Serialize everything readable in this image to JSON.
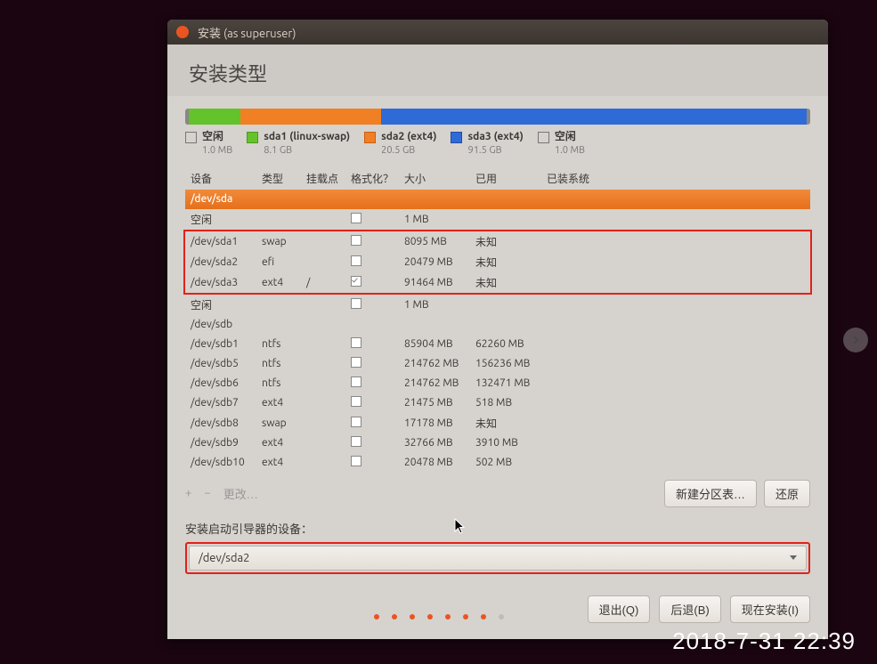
{
  "window_title": "安装 (as superuser)",
  "page_title": "安装类型",
  "legend": [
    {
      "label": "空闲",
      "sub": "1.0 MB",
      "cls": "sq-empty"
    },
    {
      "label": "sda1 (linux-swap)",
      "sub": "8.1 GB",
      "cls": "sq-green"
    },
    {
      "label": "sda2 (ext4)",
      "sub": "20.5 GB",
      "cls": "sq-orange"
    },
    {
      "label": "sda3 (ext4)",
      "sub": "91.5 GB",
      "cls": "sq-blue"
    },
    {
      "label": "空闲",
      "sub": "1.0 MB",
      "cls": "sq-empty"
    }
  ],
  "columns": {
    "device": "设备",
    "type": "类型",
    "mount": "挂载点",
    "format": "格式化？",
    "size": "大小",
    "used": "已用",
    "system": "已装系统"
  },
  "disk_a": "/dev/sda",
  "rows_a_pre": [
    {
      "device": "空闲",
      "type": "",
      "mount": "",
      "fmt": false,
      "size": "1 MB",
      "used": ""
    }
  ],
  "rows_a_boxed": [
    {
      "device": "/dev/sda1",
      "type": "swap",
      "mount": "",
      "fmt": false,
      "size": "8095 MB",
      "used": "未知"
    },
    {
      "device": "/dev/sda2",
      "type": "efi",
      "mount": "",
      "fmt": false,
      "size": "20479 MB",
      "used": "未知"
    },
    {
      "device": "/dev/sda3",
      "type": "ext4",
      "mount": "/",
      "fmt": true,
      "size": "91464 MB",
      "used": "未知"
    }
  ],
  "rows_a_post": [
    {
      "device": "空闲",
      "type": "",
      "mount": "",
      "fmt": false,
      "size": "1 MB",
      "used": ""
    }
  ],
  "disk_b": "/dev/sdb",
  "rows_b": [
    {
      "device": "/dev/sdb1",
      "type": "ntfs",
      "mount": "",
      "fmt": false,
      "size": "85904 MB",
      "used": "62260 MB"
    },
    {
      "device": "/dev/sdb5",
      "type": "ntfs",
      "mount": "",
      "fmt": false,
      "size": "214762 MB",
      "used": "156236 MB"
    },
    {
      "device": "/dev/sdb6",
      "type": "ntfs",
      "mount": "",
      "fmt": false,
      "size": "214762 MB",
      "used": "132471 MB"
    },
    {
      "device": "/dev/sdb7",
      "type": "ext4",
      "mount": "",
      "fmt": false,
      "size": "21475 MB",
      "used": "518 MB"
    },
    {
      "device": "/dev/sdb8",
      "type": "swap",
      "mount": "",
      "fmt": false,
      "size": "17178 MB",
      "used": "未知"
    },
    {
      "device": "/dev/sdb9",
      "type": "ext4",
      "mount": "",
      "fmt": false,
      "size": "32766 MB",
      "used": "3910 MB"
    },
    {
      "device": "/dev/sdb10",
      "type": "ext4",
      "mount": "",
      "fmt": false,
      "size": "20478 MB",
      "used": "502 MB"
    }
  ],
  "toolbar": {
    "add": "+",
    "remove": "−",
    "change": "更改…",
    "new_table": "新建分区表…",
    "revert": "还原"
  },
  "bootloader": {
    "label": "安装启动引导器的设备：",
    "selected": "/dev/sda2"
  },
  "footer": {
    "quit": "退出(Q)",
    "back": "后退(B)",
    "install": "现在安装(I)"
  },
  "timestamp": "2018-7-31 22:39"
}
